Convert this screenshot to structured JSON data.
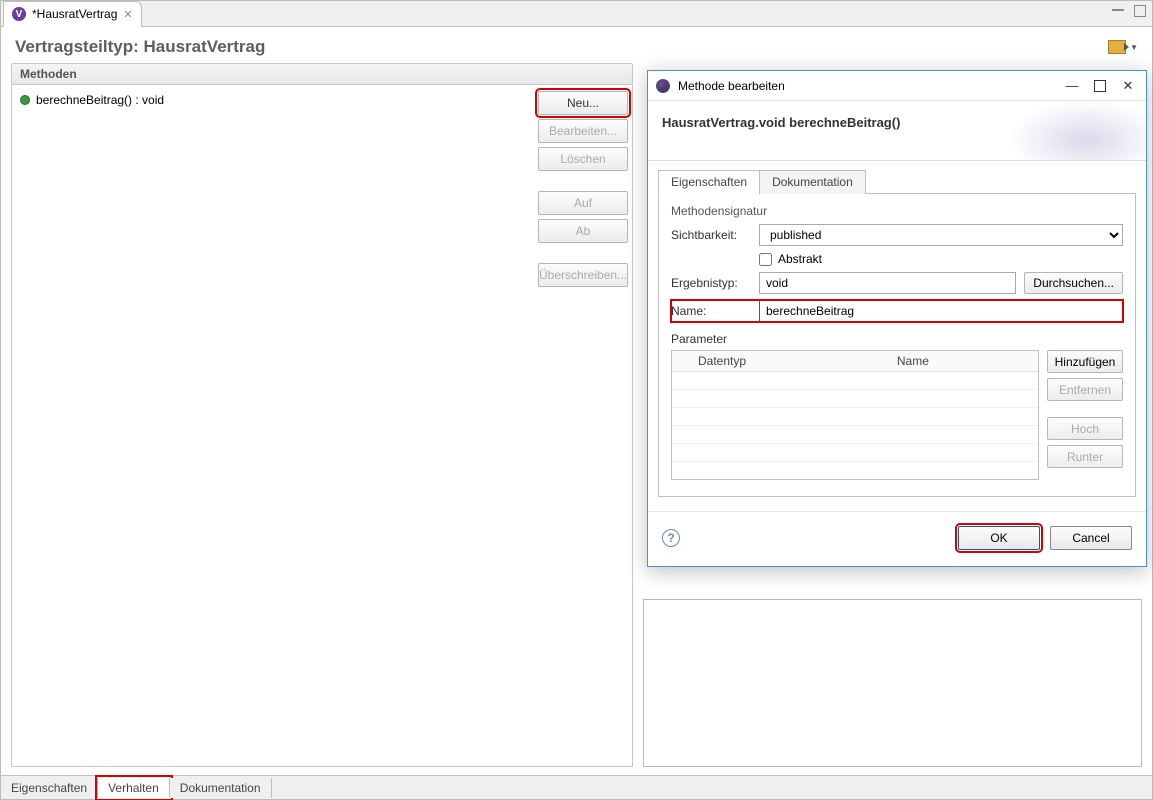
{
  "tab": {
    "title": "*HausratVertrag"
  },
  "header": {
    "title": "Vertragsteiltyp: HausratVertrag"
  },
  "section": {
    "title": "Methoden"
  },
  "methods": {
    "item0": "berechneBeitrag() : void"
  },
  "buttons": {
    "neu": "Neu...",
    "bearbeiten": "Bearbeiten...",
    "loeschen": "Löschen",
    "auf": "Auf",
    "ab": "Ab",
    "ueberschreiben": "Überschreiben..."
  },
  "bottom_tabs": {
    "eigenschaften": "Eigenschaften",
    "verhalten": "Verhalten",
    "dokumentation": "Dokumentation"
  },
  "dialog": {
    "title": "Methode bearbeiten",
    "banner": "HausratVertrag.void berechneBeitrag()",
    "tabs": {
      "eigenschaften": "Eigenschaften",
      "dokumentation": "Dokumentation"
    },
    "group": "Methodensignatur",
    "labels": {
      "sichtbarkeit": "Sichtbarkeit:",
      "abstrakt": "Abstrakt",
      "ergebnistyp": "Ergebnistyp:",
      "name": "Name:",
      "parameter": "Parameter"
    },
    "values": {
      "sichtbarkeit": "published",
      "ergebnistyp": "void",
      "name": "berechneBeitrag"
    },
    "btns": {
      "durchsuchen": "Durchsuchen...",
      "hinzufuegen": "Hinzufügen",
      "entfernen": "Entfernen",
      "hoch": "Hoch",
      "runter": "Runter",
      "ok": "OK",
      "cancel": "Cancel"
    },
    "table": {
      "col_datentyp": "Datentyp",
      "col_name": "Name"
    }
  }
}
